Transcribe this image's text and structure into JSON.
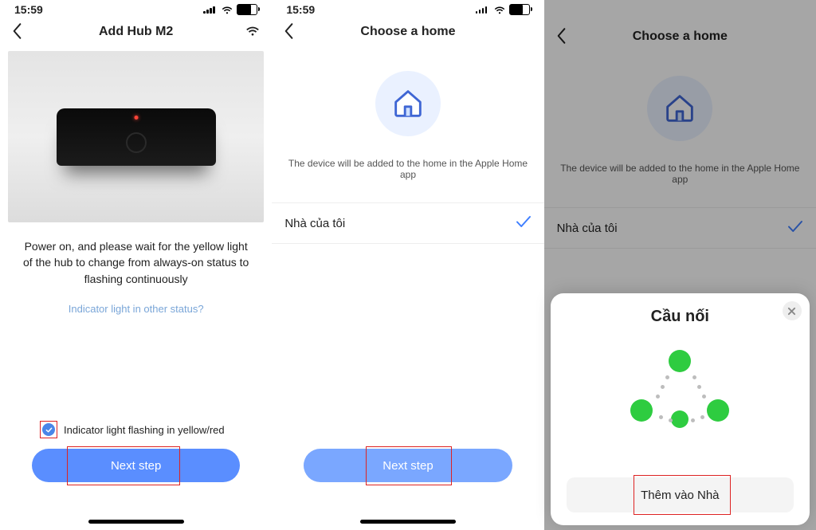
{
  "status_time": "15:59",
  "screen1": {
    "title": "Add Hub M2",
    "instruction": "Power on, and please wait for the yellow light of the hub to change from always-on status to flashing continuously",
    "link": "Indicator light in other status?",
    "checkbox_label": "Indicator light flashing in yellow/red",
    "button": "Next step"
  },
  "screen2": {
    "title": "Choose a home",
    "subtext": "The device will be added to the home in the Apple Home app",
    "home_name": "Nhà của tôi",
    "button": "Next step"
  },
  "screen3": {
    "title": "Choose a home",
    "subtext": "The device will be added to the home in the Apple Home app",
    "home_name": "Nhà của tôi",
    "modal_title": "Cầu nối",
    "modal_button": "Thêm vào Nhà"
  }
}
